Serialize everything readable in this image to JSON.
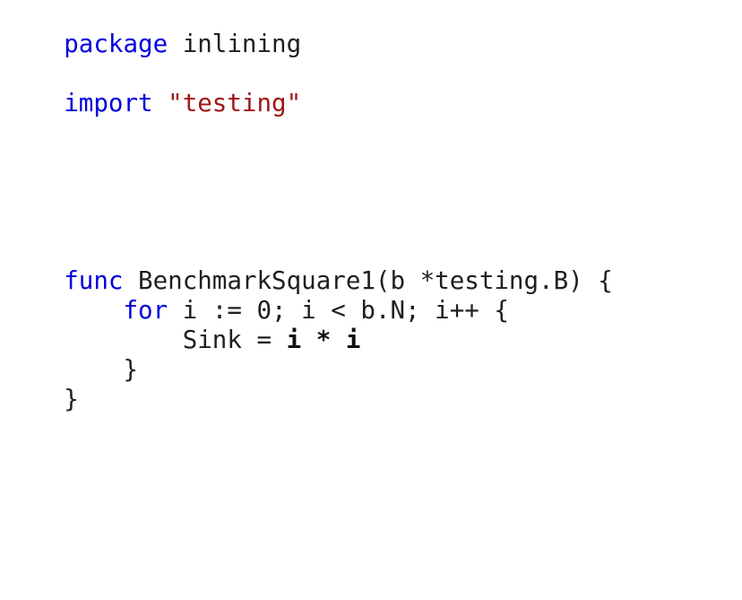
{
  "editor": {
    "language": "go",
    "colors": {
      "keyword": "#0000dd",
      "string": "#a31515",
      "text": "#1f1f1f"
    },
    "lines": {
      "l1": {
        "kw": "package",
        "rest": " inlining"
      },
      "l3": {
        "kw": "import",
        "sp": " ",
        "str": "\"testing\""
      },
      "l9": {
        "kw": "func",
        "rest": " BenchmarkSquare1(b *testing.B) {"
      },
      "l10": {
        "indent": "    ",
        "kw": "for",
        "rest": " i := 0; i < b.N; i++ {"
      },
      "l11": {
        "indent": "        ",
        "pre": "Sink = ",
        "b1": "i",
        "op": " * ",
        "b2": "i"
      },
      "l12": {
        "text": "    }"
      },
      "l13": {
        "text": "}"
      }
    }
  }
}
